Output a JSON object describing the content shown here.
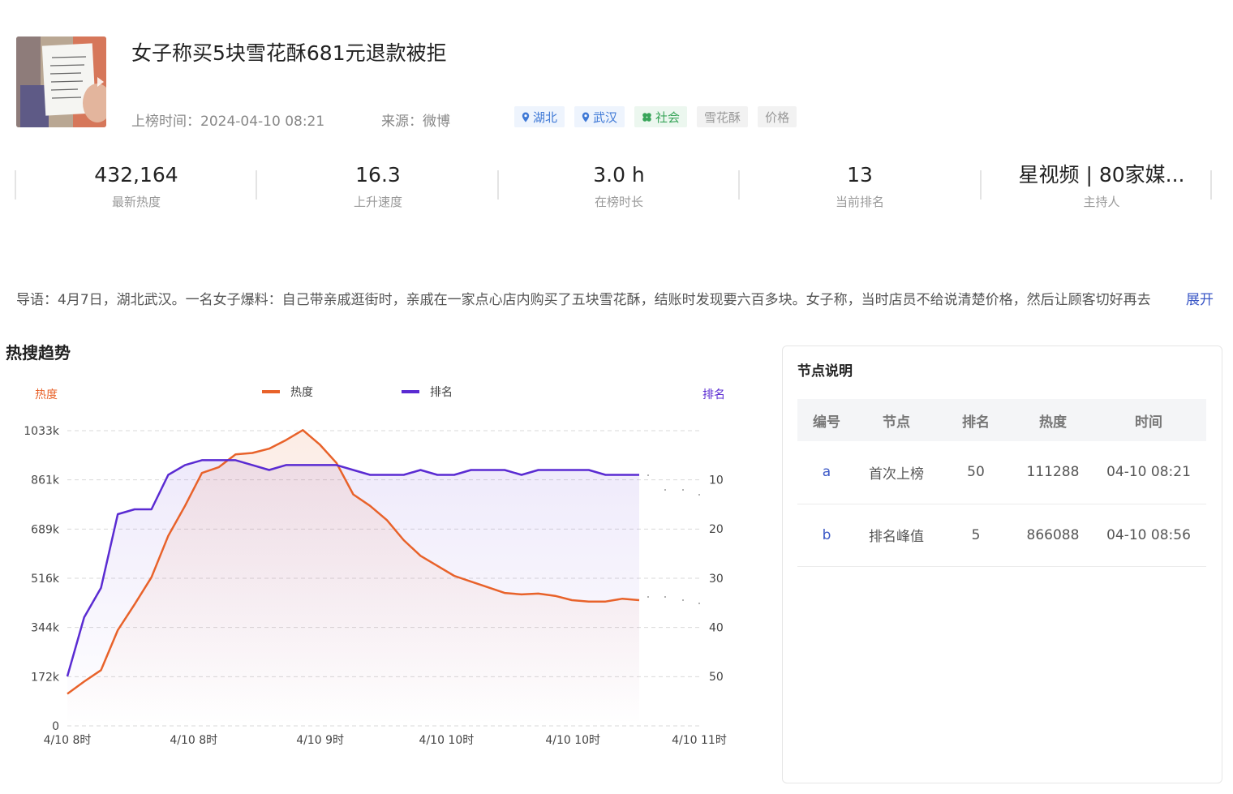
{
  "topic": {
    "title": "女子称买5块雪花酥681元退款被拒",
    "upload_time_label": "上榜时间：",
    "upload_time": "2024-04-10 08:21",
    "source_label": "来源：",
    "source": "微博",
    "tags": [
      {
        "label": "湖北",
        "kind": "location",
        "icon": "location-pin-icon"
      },
      {
        "label": "武汉",
        "kind": "location",
        "icon": "location-pin-icon"
      },
      {
        "label": "社会",
        "kind": "category",
        "icon": "clover-icon"
      },
      {
        "label": "雪花酥",
        "kind": "keyword"
      },
      {
        "label": "价格",
        "kind": "keyword"
      }
    ]
  },
  "stats": [
    {
      "value": "432,164",
      "label": "最新热度"
    },
    {
      "value": "16.3",
      "label": "上升速度"
    },
    {
      "value": "3.0 h",
      "label": "在榜时长"
    },
    {
      "value": "13",
      "label": "当前排名"
    },
    {
      "value": "星视频 | 80家媒...",
      "label": "主持人"
    }
  ],
  "intro": {
    "text": "导语：4月7日，湖北武汉。一名女子爆料：自己带亲戚逛街时，亲戚在一家点心店内购买了五块雪花酥，结账时发现要六百多块。女子称，当时店员不给说清楚价格，然后让顾客切好再去",
    "expand_label": "展开"
  },
  "trend_section_title": "热搜趋势",
  "chart_data": {
    "type": "line",
    "left_axis_label": "热度",
    "right_axis_label": "排名",
    "legend": [
      "热度",
      "排名"
    ],
    "legend_position": "top-center",
    "grid": true,
    "colors": {
      "heat": "#e8622a",
      "rank": "#5a2bd2"
    },
    "x_tick_labels": [
      "4/10 8时",
      "4/10 8时",
      "4/10 9时",
      "4/10 10时",
      "4/10 10时",
      "4/10 11时"
    ],
    "y_left_ticks": [
      "0",
      "172k",
      "344k",
      "516k",
      "689k",
      "861k",
      "1033k"
    ],
    "y_left_range": [
      0,
      1033
    ],
    "y_right_ticks": [
      "10",
      "20",
      "30",
      "40",
      "50"
    ],
    "y_right_range": [
      10,
      50
    ],
    "y_right_inverted": true,
    "series": [
      {
        "name": "热度",
        "unit": "k",
        "values": [
          112,
          155,
          195,
          335,
          425,
          520,
          665,
          770,
          885,
          905,
          950,
          955,
          970,
          1000,
          1035,
          985,
          920,
          810,
          770,
          720,
          650,
          595,
          560,
          525,
          505,
          485,
          465,
          460,
          463,
          455,
          440,
          435,
          435,
          445,
          440
        ]
      },
      {
        "name": "排名",
        "values": [
          50,
          38,
          32,
          17,
          16,
          16,
          9,
          7,
          6,
          6,
          6,
          7,
          8,
          7,
          7,
          7,
          7,
          8,
          9,
          9,
          9,
          8,
          9,
          9,
          8,
          8,
          8,
          9,
          8,
          8,
          8,
          8,
          9,
          9,
          9
        ]
      }
    ]
  },
  "nodes_panel": {
    "title": "节点说明",
    "headers": [
      "编号",
      "节点",
      "排名",
      "热度",
      "时间"
    ],
    "rows": [
      [
        "a",
        "首次上榜",
        "50",
        "111288",
        "04-10 08:21"
      ],
      [
        "b",
        "排名峰值",
        "5",
        "866088",
        "04-10 08:56"
      ]
    ]
  }
}
